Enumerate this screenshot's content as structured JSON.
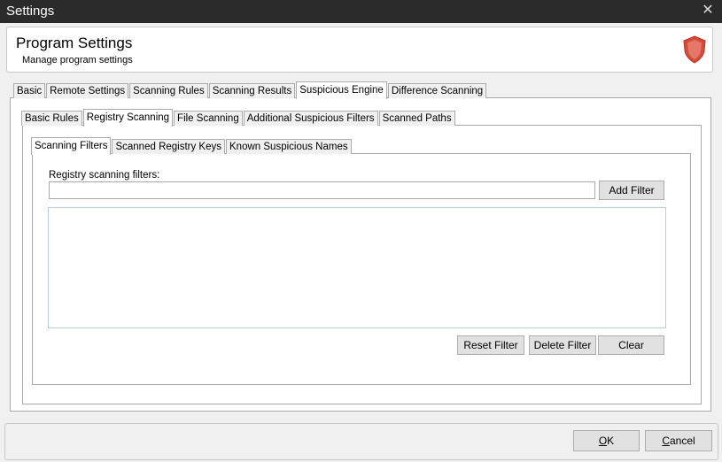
{
  "window": {
    "title": "Settings"
  },
  "header": {
    "title": "Program Settings",
    "subtitle": "Manage program settings"
  },
  "main_tabs": [
    "Basic",
    "Remote Settings",
    "Scanning Rules",
    "Scanning Results",
    "Suspicious Engine",
    "Difference Scanning"
  ],
  "main_tab_active": "Suspicious Engine",
  "sub_tabs": [
    "Basic Rules",
    "Registry Scanning",
    "File Scanning",
    "Additional Suspicious Filters",
    "Scanned Paths"
  ],
  "sub_tab_active": "Registry Scanning",
  "inner_tabs": [
    "Scanning Filters",
    "Scanned Registry Keys",
    "Known Suspicious Names"
  ],
  "inner_tab_active": "Scanning Filters",
  "filters": {
    "label": "Registry scanning filters:",
    "input_value": "",
    "add_button": "Add Filter",
    "reset_button": "Reset Filter",
    "delete_button": "Delete Filter",
    "clear_button": "Clear",
    "items": []
  },
  "footer": {
    "ok_mnemonic": "O",
    "ok_rest": "K",
    "cancel_mnemonic": "C",
    "cancel_rest": "ancel"
  },
  "colors": {
    "titlebar": "#2b2b2b",
    "shield": "#d84a3a"
  }
}
